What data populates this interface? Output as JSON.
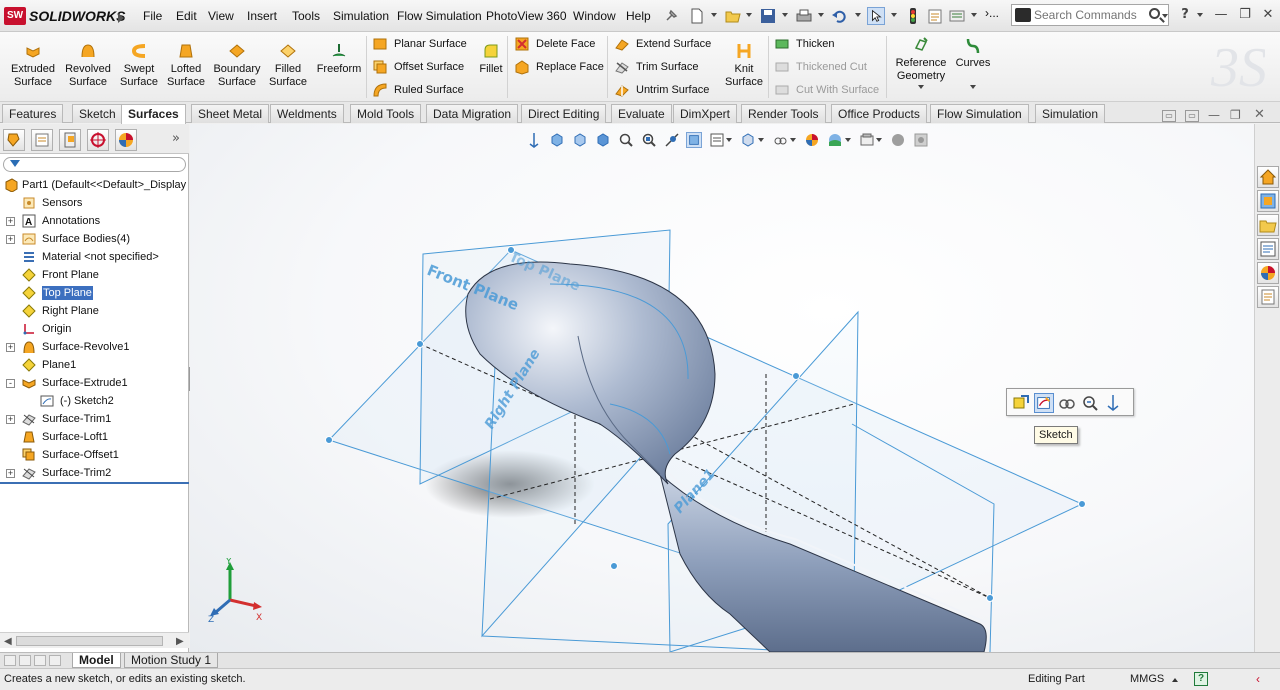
{
  "app": {
    "logo_text": "SOLIDWORKS",
    "badge": "SW"
  },
  "menu": [
    "File",
    "Edit",
    "View",
    "Insert",
    "Tools",
    "Simulation",
    "Flow Simulation",
    "PhotoView 360",
    "Window",
    "Help"
  ],
  "search": {
    "placeholder": "Search Commands"
  },
  "ribbon": {
    "big": [
      {
        "label": "Extruded\nSurface",
        "icon": "extruded-surface-icon"
      },
      {
        "label": "Revolved\nSurface",
        "icon": "revolved-surface-icon"
      },
      {
        "label": "Swept\nSurface",
        "icon": "swept-surface-icon"
      },
      {
        "label": "Lofted\nSurface",
        "icon": "lofted-surface-icon"
      },
      {
        "label": "Boundary\nSurface",
        "icon": "boundary-surface-icon"
      },
      {
        "label": "Filled\nSurface",
        "icon": "filled-surface-icon"
      },
      {
        "label": "Freeform",
        "icon": "freeform-icon"
      }
    ],
    "col1": [
      "Planar Surface",
      "Offset Surface",
      "Ruled Surface"
    ],
    "fillet": "Fillet",
    "col2": [
      "Delete Face",
      "Replace Face"
    ],
    "col3": [
      "Extend Surface",
      "Trim Surface",
      "Untrim Surface"
    ],
    "knit": "Knit\nSurface",
    "col4": [
      "Thicken",
      "Thickened Cut",
      "Cut With Surface"
    ],
    "reference_geometry": "Reference\nGeometry",
    "curves": "Curves"
  },
  "tabs": [
    "Features",
    "Sketch",
    "Surfaces",
    "Sheet Metal",
    "Weldments",
    "Mold Tools",
    "Data Migration",
    "Direct Editing",
    "Evaluate",
    "DimXpert",
    "Render Tools",
    "Office Products",
    "Flow Simulation",
    "Simulation"
  ],
  "active_tab": "Surfaces",
  "tree": [
    {
      "label": "Part1  (Default<<Default>_Display State 1>)",
      "icon": "part-icon",
      "expander": ""
    },
    {
      "label": "Sensors",
      "icon": "sensors-icon",
      "expander": ""
    },
    {
      "label": "Annotations",
      "icon": "annotations-icon",
      "expander": "+"
    },
    {
      "label": "Surface Bodies(4)",
      "icon": "surface-bodies-icon",
      "expander": "+"
    },
    {
      "label": "Material <not specified>",
      "icon": "material-icon",
      "expander": ""
    },
    {
      "label": "Front Plane",
      "icon": "plane-icon",
      "expander": ""
    },
    {
      "label": "Top Plane",
      "icon": "plane-icon",
      "expander": "",
      "selected": true
    },
    {
      "label": "Right Plane",
      "icon": "plane-icon",
      "expander": ""
    },
    {
      "label": "Origin",
      "icon": "origin-icon",
      "expander": ""
    },
    {
      "label": "Surface-Revolve1",
      "icon": "surface-revolve-icon",
      "expander": "+"
    },
    {
      "label": "Plane1",
      "icon": "plane-icon",
      "expander": ""
    },
    {
      "label": "Surface-Extrude1",
      "icon": "surface-extrude-icon",
      "expander": "-"
    },
    {
      "label": "(-) Sketch2",
      "icon": "sketch-icon",
      "expander": "",
      "indent": true
    },
    {
      "label": "Surface-Trim1",
      "icon": "surface-trim-icon",
      "expander": "+"
    },
    {
      "label": "Surface-Loft1",
      "icon": "surface-loft-icon",
      "expander": ""
    },
    {
      "label": "Surface-Offset1",
      "icon": "surface-offset-icon",
      "expander": ""
    },
    {
      "label": "Surface-Trim2",
      "icon": "surface-trim-icon",
      "expander": "+"
    }
  ],
  "viewport": {
    "plane_labels": [
      "Front Plane",
      "Top Plane",
      "Right Plane",
      "Plane1"
    ],
    "tooltip": "Sketch",
    "triad": {
      "x": "X",
      "y": "Y",
      "z": "Z"
    }
  },
  "bottom_tabs": [
    "Model",
    "Motion Study 1"
  ],
  "status": {
    "message": "Creates a new sketch, or edits an existing sketch.",
    "mode": "Editing Part",
    "units": "MMGS",
    "help": "?"
  },
  "colors": {
    "plane_blue": "#4a9ad6",
    "model_blue": "#8fa5c4",
    "selection": "#3c6fbf",
    "sw_red": "#c8102e"
  }
}
